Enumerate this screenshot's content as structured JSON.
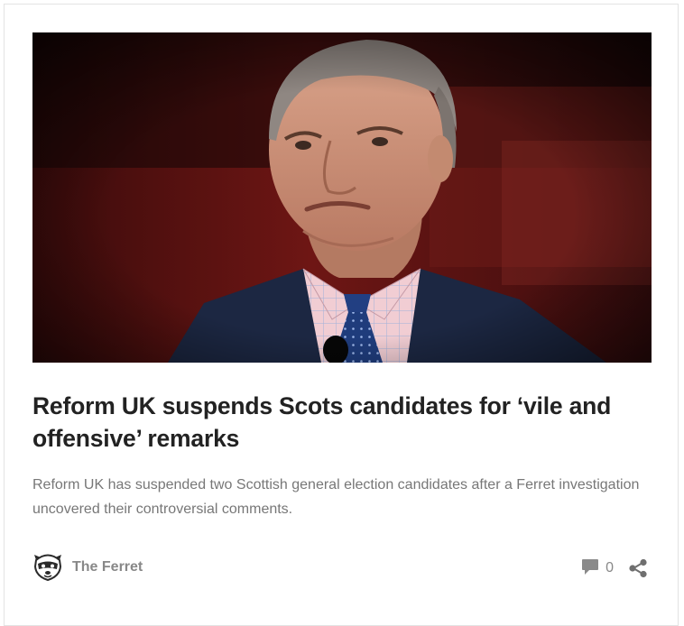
{
  "post": {
    "image_alt": "Politician in a navy suit, pink check shirt and blue tie, with a downturned expression",
    "title": "Reform UK suspends Scots candidates for ‘vile and offensive’ remarks",
    "excerpt": "Reform UK has suspended two Scottish general election candidates after a Ferret investigation uncovered their controversial comments.",
    "author": {
      "name": "The Ferret",
      "avatar_icon": "ferret-logo-icon"
    },
    "comments": {
      "icon": "comment-bubble-icon",
      "count": "0"
    },
    "share": {
      "icon": "share-icon"
    }
  },
  "colors": {
    "title": "#222222",
    "excerpt": "#777777",
    "meta": "#888888",
    "border": "#e3e3e3"
  }
}
